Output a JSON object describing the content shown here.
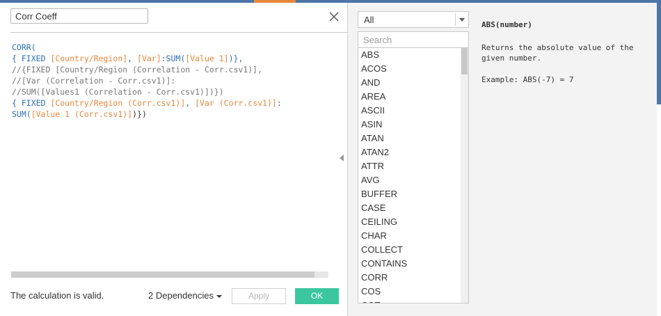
{
  "dialog": {
    "calc_name": "Corr Coeff",
    "close_icon": "close-icon"
  },
  "formula": {
    "lines": [
      [
        {
          "t": "kw",
          "v": "CORR("
        }
      ],
      [
        {
          "t": "kw",
          "v": "{ FIXED "
        },
        {
          "t": "fld",
          "v": "[Country/Region]"
        },
        {
          "t": "kw",
          "v": ", "
        },
        {
          "t": "fld",
          "v": "[Var]"
        },
        {
          "t": "kw",
          "v": ":SUM("
        },
        {
          "t": "fld",
          "v": "[Value 1]"
        },
        {
          "t": "kw",
          "v": ")},"
        }
      ],
      [
        {
          "t": "cmt",
          "v": "//{FIXED [Country/Region (Correlation - Corr.csv1)],"
        }
      ],
      [
        {
          "t": "cmt",
          "v": "//[Var (Correlation - Corr.csv1)]:"
        }
      ],
      [
        {
          "t": "cmt",
          "v": "//SUM([Values1 (Correlation - Corr.csv1)])})"
        }
      ],
      [
        {
          "t": "kw",
          "v": "{ FIXED "
        },
        {
          "t": "fld",
          "v": "[Country/Region (Corr.csv1)]"
        },
        {
          "t": "kw",
          "v": ", "
        },
        {
          "t": "fld",
          "v": "[Var (Corr.csv1)]"
        },
        {
          "t": "kw",
          "v": ":"
        }
      ],
      [
        {
          "t": "kw",
          "v": "SUM("
        },
        {
          "t": "fld",
          "v": "[Value 1 (Corr.csv1)]"
        },
        {
          "t": "pl",
          "v": ")})"
        }
      ]
    ]
  },
  "footer": {
    "status": "The calculation is valid.",
    "dependencies": "2 Dependencies",
    "apply_label": "Apply",
    "ok_label": "OK"
  },
  "functions": {
    "category": "All",
    "search_placeholder": "Search",
    "items": [
      "ABS",
      "ACOS",
      "AND",
      "AREA",
      "ASCII",
      "ASIN",
      "ATAN",
      "ATAN2",
      "ATTR",
      "AVG",
      "BUFFER",
      "CASE",
      "CEILING",
      "CHAR",
      "COLLECT",
      "CONTAINS",
      "CORR",
      "COS",
      "COT"
    ]
  },
  "help": {
    "signature": "ABS(number)",
    "description": "Returns the absolute value of the given number.",
    "example": "Example: ABS(-7) = 7"
  },
  "colors": {
    "keyword": "#2b6fb5",
    "field": "#e8873a",
    "comment": "#767676",
    "ok_button": "#3cc6a0",
    "header_strip": "#4d74a6"
  }
}
